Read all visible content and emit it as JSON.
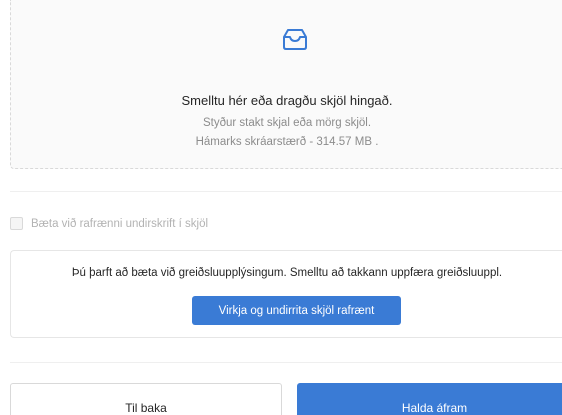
{
  "upload": {
    "icon": "inbox-icon",
    "title": "Smelltu hér eða dragðu skjöl hingað.",
    "hint_single_multi": "Styður stakt skjal eða mörg skjöl.",
    "hint_max_size": "Hámarks skráarstærð - 314.57 MB ."
  },
  "signature": {
    "checkbox_label": "Bæta við rafrænni undirskrift í skjöl",
    "checked": false
  },
  "payment": {
    "notice": "Þú þarft að bæta við greiðsluupplýsingum. Smelltu að takkann uppfæra greiðsluuppl.",
    "sign_button": "Virkja og undirrita skjöl rafrænt"
  },
  "footer": {
    "back_label": "Til baka",
    "continue_label": "Halda áfram"
  },
  "colors": {
    "primary": "#3a7bd5",
    "icon": "#3a7bd5"
  }
}
